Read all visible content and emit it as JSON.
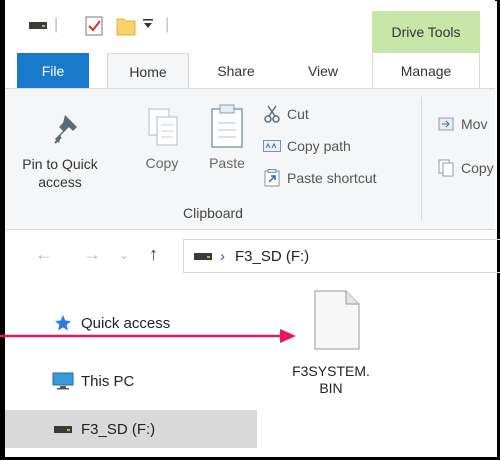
{
  "titlebar": {
    "context_tab": "Drive Tools"
  },
  "tabs": [
    {
      "label": "File"
    },
    {
      "label": "Home"
    },
    {
      "label": "Share"
    },
    {
      "label": "View"
    },
    {
      "label": "Manage"
    }
  ],
  "ribbon": {
    "pin_label": "Pin to Quick access",
    "pin_line1": "Pin to Quick",
    "pin_line2": "access",
    "copy_label": "Copy",
    "paste_label": "Paste",
    "cut_label": "Cut",
    "copy_path_label": "Copy path",
    "paste_shortcut_label": "Paste shortcut",
    "group_label": "Clipboard",
    "move_label": "Mov",
    "copy_to_label": "Copy"
  },
  "address": {
    "path": "F3_SD (F:)",
    "separator": "›"
  },
  "navpane": {
    "items": [
      {
        "label": "Quick access",
        "icon": "star-icon"
      },
      {
        "label": "This PC",
        "icon": "monitor-icon"
      },
      {
        "label": "F3_SD (F:)",
        "icon": "drive-icon",
        "selected": true
      }
    ]
  },
  "content": {
    "files": [
      {
        "name_line1": "F3SYSTEM.",
        "name_line2": "BIN",
        "icon": "file-icon"
      }
    ]
  },
  "colors": {
    "file_tab": "#1979ca",
    "drive_tools": "#c8e6a8",
    "annotation_arrow": "#e8175d",
    "selected_nav": "#d9d9d9"
  }
}
